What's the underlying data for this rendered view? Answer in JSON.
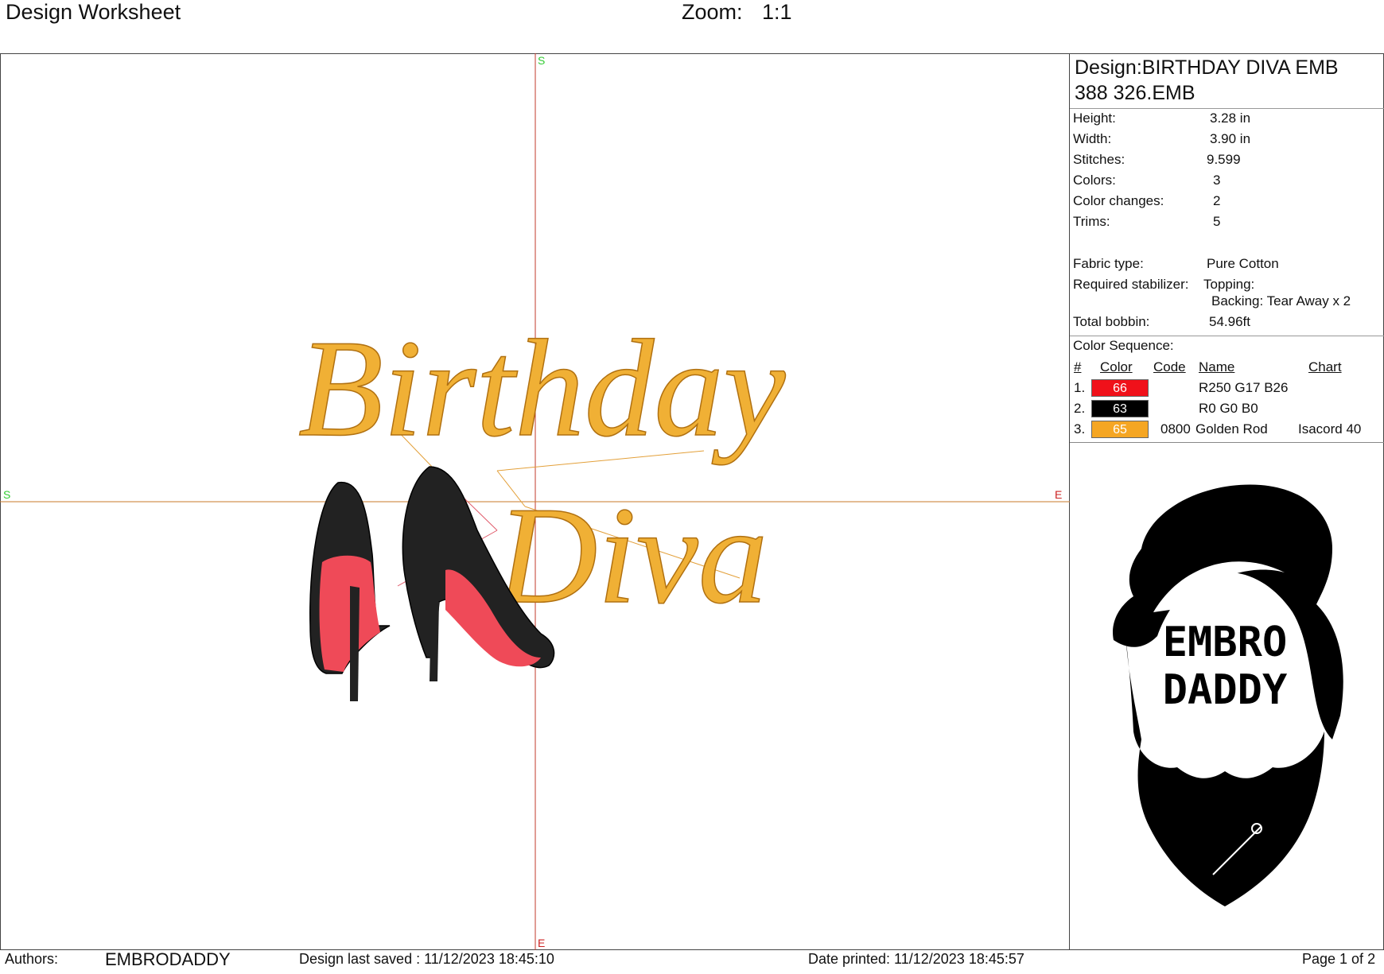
{
  "header": {
    "title": "Design Worksheet",
    "zoom_label": "Zoom:",
    "zoom_value": "1:1"
  },
  "canvas": {
    "markers": {
      "top": "S",
      "left": "S",
      "right": "E",
      "bottom": "E"
    },
    "design_text_line1": "Birthday",
    "design_text_line2": "Diva"
  },
  "info": {
    "design_name": "Design:BIRTHDAY DIVA EMB 388 326.EMB",
    "height_label": "Height:",
    "height_value": "3.28 in",
    "width_label": "Width:",
    "width_value": "3.90 in",
    "stitches_label": "Stitches:",
    "stitches_value": "9.599",
    "colors_label": "Colors:",
    "colors_value": "3",
    "color_changes_label": "Color changes:",
    "color_changes_value": "2",
    "trims_label": "Trims:",
    "trims_value": "5",
    "fabric_label": "Fabric type:",
    "fabric_value": "Pure Cotton",
    "stabilizer_label": "Required stabilizer:",
    "topping_value": "Topping:",
    "backing_value": "Backing: Tear Away x 2",
    "bobbin_label": "Total bobbin:",
    "bobbin_value": "54.96ft"
  },
  "color_sequence": {
    "title": "Color Sequence:",
    "headers": {
      "num": "#",
      "color": "Color",
      "code": "Code",
      "name": "Name",
      "chart": "Chart"
    },
    "rows": [
      {
        "num": "1.",
        "swatch": "66",
        "swatch_color": "#f0111a",
        "code": "",
        "name": "R250 G17 B26",
        "chart": ""
      },
      {
        "num": "2.",
        "swatch": "63",
        "swatch_color": "#000000",
        "code": "",
        "name": "R0 G0 B0",
        "chart": ""
      },
      {
        "num": "3.",
        "swatch": "65",
        "swatch_color": "#f5a623",
        "code": "0800",
        "name": "Golden Rod",
        "chart": "Isacord 40"
      }
    ]
  },
  "logo": {
    "line1": "EMBRO",
    "line2": "DADDY"
  },
  "footer": {
    "authors_label": "Authors:",
    "authors_value": "EMBRODADDY",
    "saved": "Design last saved : 11/12/2023 18:45:10",
    "printed": "Date printed: 11/12/2023 18:45:57",
    "page": "Page 1 of 2"
  },
  "colors": {
    "gold": "#f0b035",
    "gold_dark": "#d9921a",
    "red": "#f0111a",
    "green_marker": "#33cc33",
    "red_marker": "#cc2222",
    "crosshair": "#c87a2a"
  }
}
